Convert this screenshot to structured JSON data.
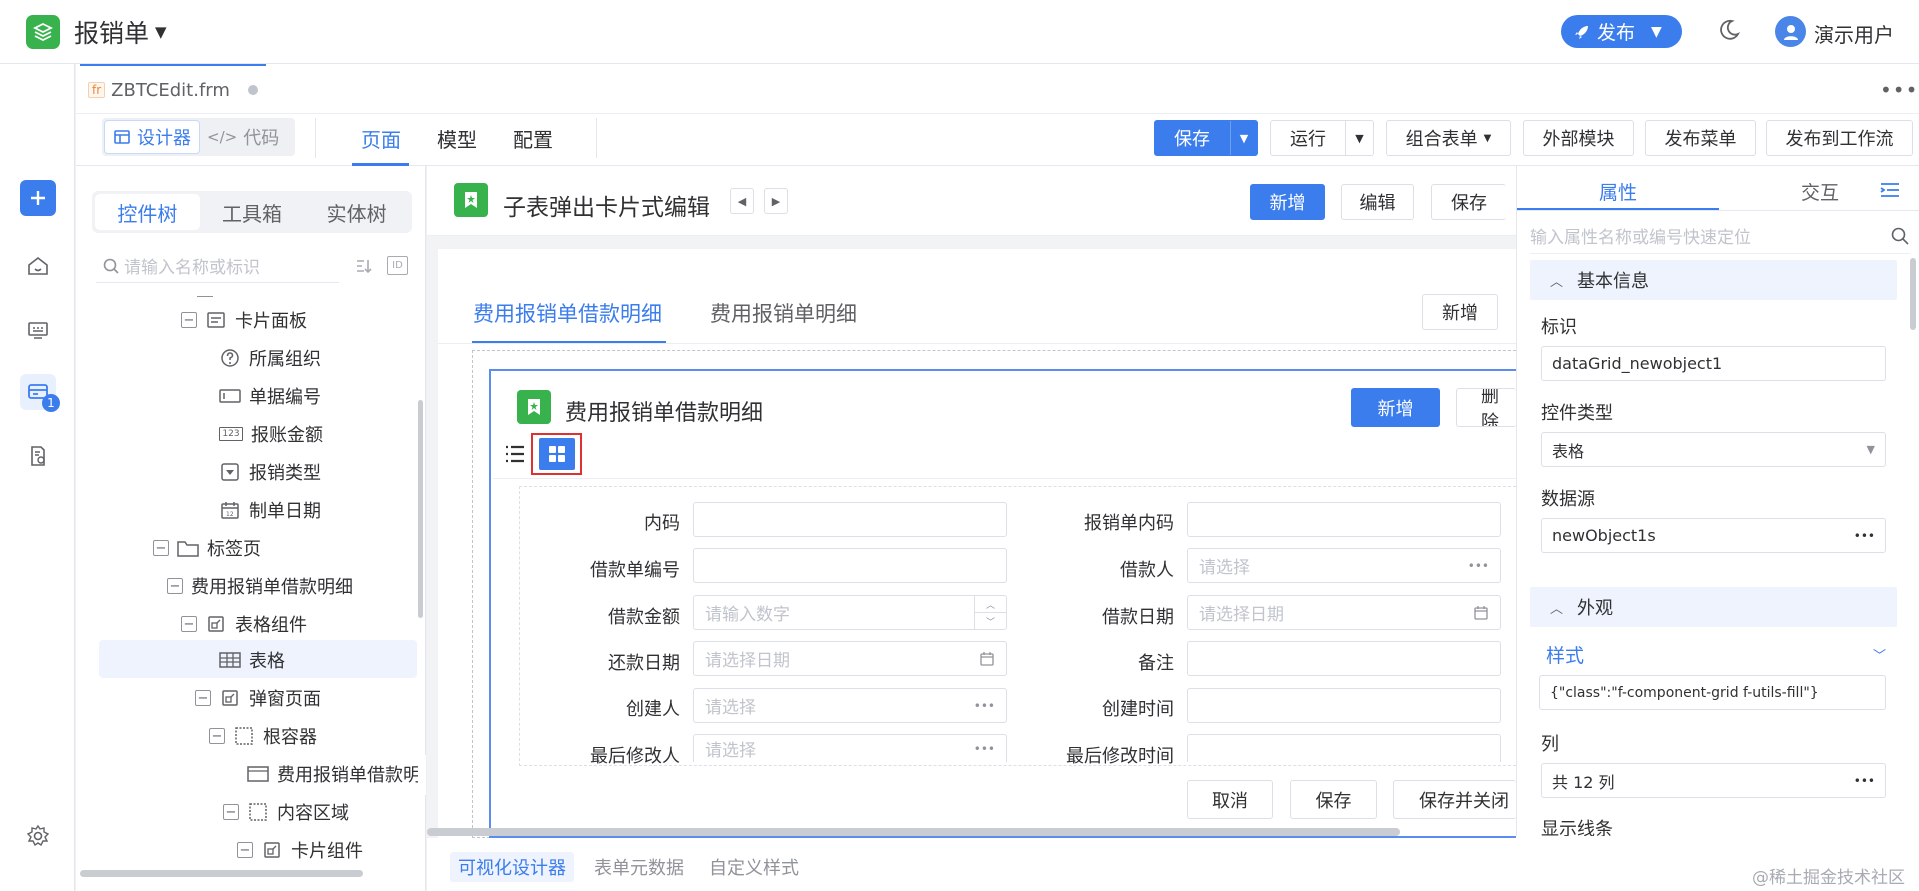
{
  "app": {
    "title": "报销单",
    "publish_label": "发布",
    "user_name": "演示用户",
    "accent": "#3b7ded",
    "logo_color": "#37b24d"
  },
  "file_tab": {
    "name": "ZBTCEdit.frm",
    "type_badge": "fr"
  },
  "toolbar": {
    "mode_designer": "设计器",
    "mode_code": "代码",
    "page_tabs": [
      "页面",
      "模型",
      "配置"
    ],
    "save": "保存",
    "run": "运行",
    "combo_form": "组合表单",
    "external_module": "外部模块",
    "publish_menu": "发布菜单",
    "publish_workflow": "发布到工作流"
  },
  "left_nav": {
    "badge_count": "1"
  },
  "left_panel": {
    "tabs": [
      "控件树",
      "工具箱",
      "实体树"
    ],
    "search_placeholder": "请输入名称或标识",
    "tree": [
      {
        "label": "卡片面板",
        "icon": "card-panel-icon"
      },
      {
        "label": "所属组织",
        "icon": "help-circle-icon"
      },
      {
        "label": "单据编号",
        "icon": "textbox-icon"
      },
      {
        "label": "报账金额",
        "icon": "number-icon"
      },
      {
        "label": "报销类型",
        "icon": "dropdown-icon"
      },
      {
        "label": "制单日期",
        "icon": "calendar-icon"
      },
      {
        "label": "标签页",
        "icon": "folder-tab-icon"
      },
      {
        "label": "费用报销单借款明细",
        "icon": ""
      },
      {
        "label": "表格组件",
        "icon": "component-icon"
      },
      {
        "label": "表格",
        "icon": "table-icon"
      },
      {
        "label": "弹窗页面",
        "icon": "component-icon"
      },
      {
        "label": "根容器",
        "icon": "container-icon"
      },
      {
        "label": "费用报销单借款明",
        "icon": "section-icon"
      },
      {
        "label": "内容区域",
        "icon": "container-icon"
      },
      {
        "label": "卡片组件",
        "icon": "component-icon"
      }
    ]
  },
  "canvas": {
    "page_title": "子表弹出卡片式编辑",
    "head_buttons": [
      "新增",
      "编辑",
      "保存"
    ],
    "tabs": [
      "费用报销单借款明细",
      "费用报销单明细"
    ],
    "tab_add": "新增",
    "card_title": "费用报销单借款明细",
    "card_add": "新增",
    "card_delete": "删除",
    "fields_left": [
      {
        "label": "内码",
        "placeholder": ""
      },
      {
        "label": "借款单编号",
        "placeholder": ""
      },
      {
        "label": "借款金额",
        "placeholder": "请输入数字"
      },
      {
        "label": "还款日期",
        "placeholder": "请选择日期"
      },
      {
        "label": "创建人",
        "placeholder": "请选择"
      },
      {
        "label": "最后修改人",
        "placeholder": "请选择"
      }
    ],
    "fields_right": [
      {
        "label": "报销单内码",
        "placeholder": ""
      },
      {
        "label": "借款人",
        "placeholder": "请选择"
      },
      {
        "label": "借款日期",
        "placeholder": "请选择日期"
      },
      {
        "label": "备注",
        "placeholder": ""
      },
      {
        "label": "创建时间",
        "placeholder": ""
      },
      {
        "label": "最后修改时间",
        "placeholder": ""
      }
    ],
    "footer_buttons": [
      "取消",
      "保存",
      "保存并关闭"
    ]
  },
  "bottom_tabs": [
    "可视化设计器",
    "表单元数据",
    "自定义样式"
  ],
  "right_panel": {
    "tabs": [
      "属性",
      "交互"
    ],
    "search_placeholder": "输入属性名称或编号快速定位",
    "section_basic": "基本信息",
    "id_label": "标识",
    "id_value": "dataGrid_newobject1",
    "type_label": "控件类型",
    "type_value": "表格",
    "source_label": "数据源",
    "source_value": "newObject1s",
    "section_appearance": "外观",
    "style_label": "样式",
    "style_value": "{\"class\":\"f-component-grid f-utils-fill\"}",
    "columns_label": "列",
    "columns_value": "共 12 列",
    "show_lines_label": "显示线条"
  },
  "watermark": "@稀土掘金技术社区"
}
